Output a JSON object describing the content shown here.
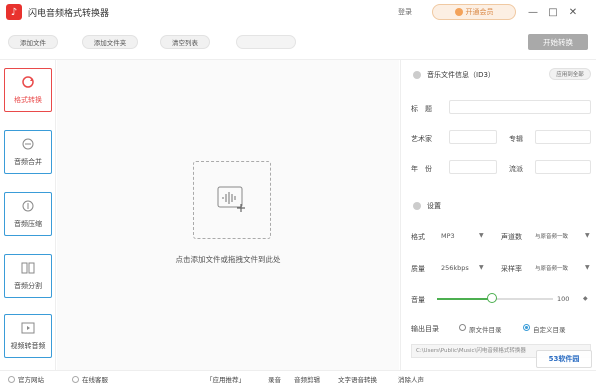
{
  "titlebar": {
    "app_title": "闪电音频格式转换器",
    "login": "登录",
    "vip": "开通会员",
    "minimize": "—",
    "maximize": "□",
    "close": "✕"
  },
  "toolbar": {
    "add_file": "添加文件",
    "add_folder": "添加文件夹",
    "clear_list": "清空列表",
    "start": "开始转换"
  },
  "leftnav": {
    "items": [
      {
        "label": "格式转换",
        "icon": "refresh-icon",
        "active": true
      },
      {
        "label": "音频合并",
        "icon": "merge-icon",
        "active": false
      },
      {
        "label": "音频压缩",
        "icon": "compress-icon",
        "active": false
      },
      {
        "label": "音频分割",
        "icon": "split-icon",
        "active": false
      },
      {
        "label": "视频转音频",
        "icon": "video-icon",
        "active": false
      }
    ]
  },
  "center": {
    "hint": "点击添加文件或拖拽文件到此处"
  },
  "rightpanel": {
    "id3_title": "音乐文件信息（ID3）",
    "apply_all": "应用到全部",
    "fields": {
      "title": "标　题",
      "artist": "艺术家",
      "album": "专辑",
      "year": "年　份",
      "genre": "流派"
    },
    "settings_title": "设置",
    "format_label": "格式",
    "format_value": "MP3",
    "channels_label": "声道数",
    "channels_value": "与原音频一致",
    "quality_label": "质量",
    "quality_value": "256kbps",
    "samplerate_label": "采样率",
    "samplerate_value": "与原音频一致",
    "volume_label": "音量",
    "volume_value": "100",
    "volume_fraction": 0.47,
    "output_label": "输出目录",
    "output_opt1": "原文件目录",
    "output_opt2": "自定义目录",
    "output_path": "C:\\Users\\Public\\Music\\闪电音频格式转换器"
  },
  "bottombar": {
    "official_site": "官方网站",
    "online_service": "在线客服",
    "app_recommend": "「应用推荐」",
    "record": "录音",
    "audio_edit": "音频剪辑",
    "text_to_speech": "文字语音转换",
    "vocal_remove": "消除人声"
  },
  "watermark": {
    "text": "53软件园"
  },
  "colors": {
    "accent_red": "#e94a4a",
    "accent_blue": "#3a9cd8",
    "slider_green": "#4caf50",
    "start_disabled": "#a9a9a9"
  }
}
